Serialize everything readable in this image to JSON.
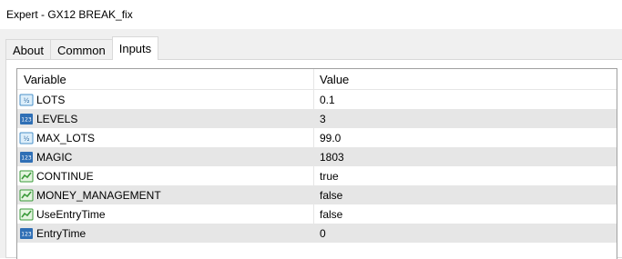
{
  "window": {
    "title": "Expert - GX12 BREAK_fix"
  },
  "tabs": [
    {
      "label": "About",
      "active": false
    },
    {
      "label": "Common",
      "active": false
    },
    {
      "label": "Inputs",
      "active": true
    }
  ],
  "grid": {
    "columns": {
      "variable": "Variable",
      "value": "Value"
    },
    "rows": [
      {
        "name": "LOTS",
        "value": "0.1",
        "icon": "double-type-icon"
      },
      {
        "name": "LEVELS",
        "value": "3",
        "icon": "integer-type-icon"
      },
      {
        "name": "MAX_LOTS",
        "value": "99.0",
        "icon": "double-type-icon"
      },
      {
        "name": "MAGIC",
        "value": "1803",
        "icon": "integer-type-icon"
      },
      {
        "name": "CONTINUE",
        "value": "true",
        "icon": "bool-type-icon"
      },
      {
        "name": "MONEY_MANAGEMENT",
        "value": "false",
        "icon": "bool-type-icon"
      },
      {
        "name": "UseEntryTime",
        "value": "false",
        "icon": "bool-type-icon"
      },
      {
        "name": "EntryTime",
        "value": "0",
        "icon": "integer-type-icon"
      }
    ]
  },
  "colors": {
    "double_icon": "#4a90c8",
    "integer_icon": "#2f6fb5",
    "bool_icon": "#3a9a3a",
    "alt_row": "#e6e6e6"
  }
}
